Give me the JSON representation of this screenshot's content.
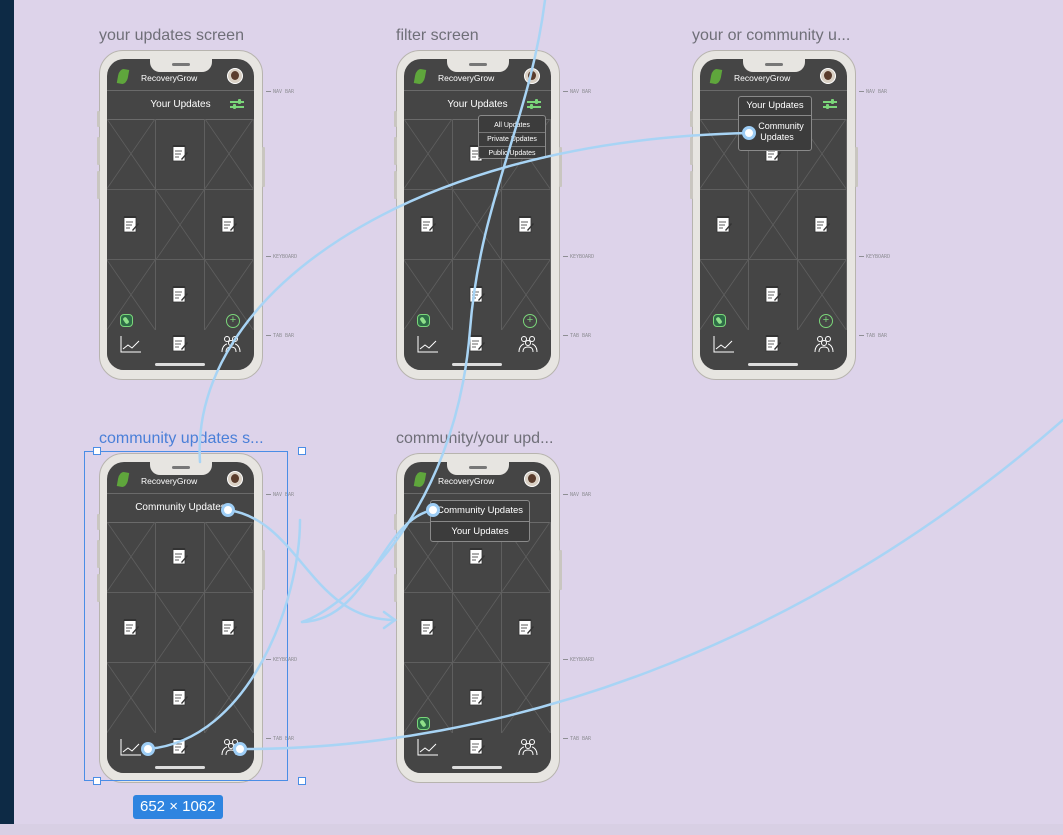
{
  "app_name": "RecoveryGrow",
  "frames": [
    {
      "title": "your updates screen",
      "screen_title": "Your Updates"
    },
    {
      "title": "filter screen",
      "screen_title": "Your Updates"
    },
    {
      "title": "your or community u...",
      "screen_title": "Your Updates"
    },
    {
      "title": "community updates s...",
      "screen_title": "Community Updates"
    },
    {
      "title": "community/your upd...",
      "screen_title": ""
    }
  ],
  "annotations": {
    "nav_bar": "NAV BAR",
    "keyboard": "KEYBOARD",
    "tab_bar": "TAB BAR"
  },
  "filter_menu": [
    "All Updates",
    "Private Updates",
    "Public Updates"
  ],
  "community_menu": {
    "line1": "Community",
    "line2": "Updates"
  },
  "switch_menu": [
    "Community Updates",
    "Your Updates"
  ],
  "selection": {
    "dimensions": "652 × 1062"
  },
  "colors": {
    "canvas": "#ddd3ea",
    "screen": "#454545",
    "accent_green": "#7bd67a",
    "wire": "#a8d4f5",
    "selection": "#4a8de6"
  },
  "icons": [
    "leaf-logo-icon",
    "avatar-icon",
    "filter-sliders-icon",
    "notepad-pencil-icon",
    "chart-line-icon",
    "people-group-icon",
    "plus-icon",
    "ticket-icon"
  ]
}
